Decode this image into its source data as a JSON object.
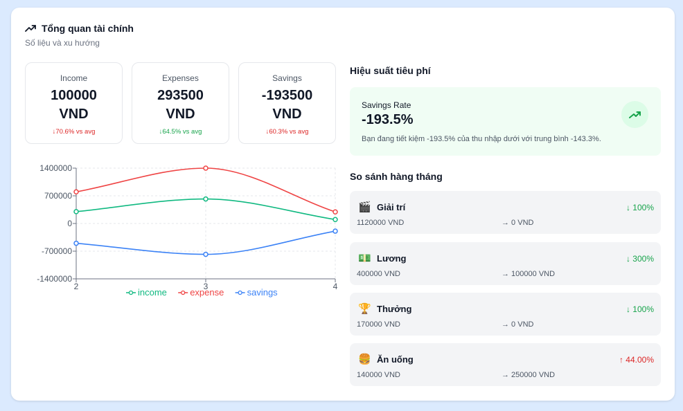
{
  "header": {
    "title": "Tổng quan tài chính",
    "subtitle": "Số liệu và xu hướng"
  },
  "stats": [
    {
      "label": "Income",
      "value": "100000",
      "unit": "VND",
      "change": "↓70.6% vs avg",
      "status_color": "#dc2626"
    },
    {
      "label": "Expenses",
      "value": "293500",
      "unit": "VND",
      "change": "↓64.5% vs avg",
      "status_color": "#16a34a"
    },
    {
      "label": "Savings",
      "value": "-193500",
      "unit": "VND",
      "change": "↓60.3% vs avg",
      "status_color": "#dc2626"
    }
  ],
  "chart_data": {
    "type": "line",
    "x": [
      2,
      3,
      4
    ],
    "ylim": [
      -1400000,
      1400000
    ],
    "yticks": [
      "1400000",
      "700000",
      "0",
      "-700000",
      "-1400000"
    ],
    "xticks": [
      "2",
      "3",
      "4"
    ],
    "legend_position": "bottom",
    "grid": true,
    "series": [
      {
        "name": "income",
        "color": "#10b981",
        "values": [
          300000,
          620000,
          100000
        ]
      },
      {
        "name": "expense",
        "color": "#ef4444",
        "values": [
          800000,
          1400000,
          293500
        ]
      },
      {
        "name": "savings",
        "color": "#3b82f6",
        "values": [
          -500000,
          -780000,
          -193500
        ]
      }
    ]
  },
  "performance": {
    "title": "Hiệu suất tiêu phí",
    "rate_label": "Savings Rate",
    "rate_value": "-193.5%",
    "description": "Bạn đang tiết kiệm -193.5% của thu nhập dưới với trung bình -143.3%.",
    "accent": "#16a34a"
  },
  "monthly": {
    "title": "So sánh hàng tháng",
    "rows": [
      {
        "icon": "🎬",
        "icon_name": "clapperboard-icon",
        "name": "Giải trí",
        "change": "↓ 100%",
        "status_color": "#16a34a",
        "from": "1120000 VND",
        "to": "→  0 VND"
      },
      {
        "icon": "💵",
        "icon_name": "money-icon",
        "name": "Lương",
        "change": "↓ 300%",
        "status_color": "#16a34a",
        "from": "400000 VND",
        "to": "→  100000 VND"
      },
      {
        "icon": "🏆",
        "icon_name": "trophy-icon",
        "name": "Thưởng",
        "change": "↓ 100%",
        "status_color": "#16a34a",
        "from": "170000 VND",
        "to": "→  0 VND"
      },
      {
        "icon": "🍔",
        "icon_name": "burger-icon",
        "name": "Ăn uống",
        "change": "↑ 44.00%",
        "status_color": "#dc2626",
        "from": "140000 VND",
        "to": "→  250000 VND"
      }
    ]
  }
}
